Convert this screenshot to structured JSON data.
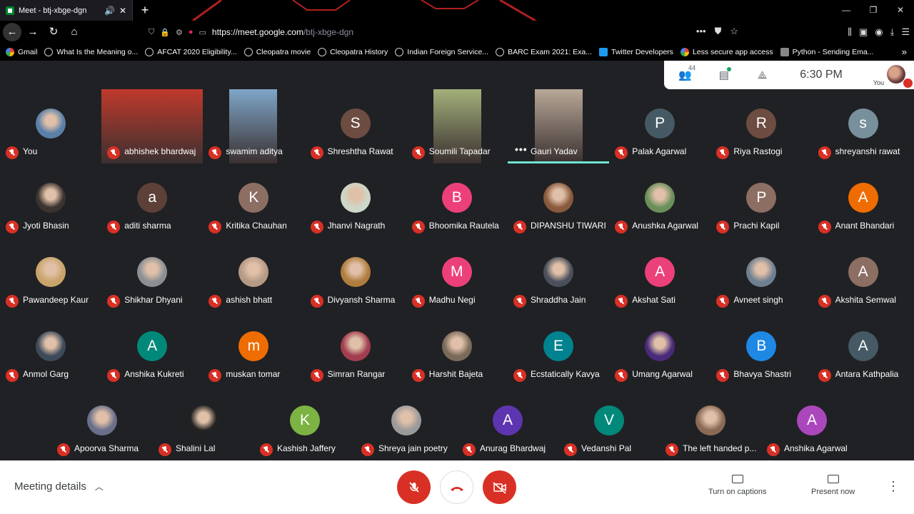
{
  "browser": {
    "tab_title": "Meet - btj-xbge-dgn",
    "url_domain": "https://meet.google.com",
    "url_path": "/btj-xbge-dgn",
    "bookmarks": [
      {
        "label": "Gmail",
        "icon": "google-icon"
      },
      {
        "label": "What Is the Meaning o...",
        "icon": "globe-icon"
      },
      {
        "label": "AFCAT 2020 Eligibility...",
        "icon": "globe-icon"
      },
      {
        "label": "Cleopatra movie",
        "icon": "globe-icon"
      },
      {
        "label": "Cleopatra History",
        "icon": "globe-icon"
      },
      {
        "label": "Indian Foreign Service...",
        "icon": "globe-icon"
      },
      {
        "label": "BARC Exam 2021: Exa...",
        "icon": "globe-icon"
      },
      {
        "label": "Twitter Developers",
        "icon": "twitter-icon"
      },
      {
        "label": "Less secure app access",
        "icon": "google-icon"
      },
      {
        "label": "Python - Sending Ema...",
        "icon": "python-icon"
      }
    ]
  },
  "meet": {
    "participant_count": "44",
    "time": "6:30 PM",
    "self_label": "You",
    "participants": [
      {
        "name": "You",
        "type": "photo",
        "color": "#5a7fa8"
      },
      {
        "name": "abhishek bhardwaj",
        "type": "video",
        "color": "#c0392b"
      },
      {
        "name": "swamim aditya",
        "type": "video",
        "color": "#7fa6c9"
      },
      {
        "name": "Shreshtha Rawat",
        "type": "letter",
        "letter": "S",
        "color": "#6d4c41"
      },
      {
        "name": "Soumili Tapadar",
        "type": "video",
        "color": "#a3b07a"
      },
      {
        "name": "Gauri Yadav",
        "type": "video",
        "color": "#b8a898",
        "speaking": true
      },
      {
        "name": "Palak Agarwal",
        "type": "letter",
        "letter": "P",
        "color": "#455a64"
      },
      {
        "name": "Riya Rastogi",
        "type": "letter",
        "letter": "R",
        "color": "#6d4c41"
      },
      {
        "name": "shreyanshi rawat",
        "type": "letter",
        "letter": "s",
        "color": "#78909c"
      },
      {
        "name": "Jyoti Bhasin",
        "type": "photo",
        "color": "#3a3330"
      },
      {
        "name": "aditi sharma",
        "type": "letter",
        "letter": "a",
        "color": "#5d4037"
      },
      {
        "name": "Kritika Chauhan",
        "type": "letter",
        "letter": "K",
        "color": "#8d6e63"
      },
      {
        "name": "Jhanvi Nagrath",
        "type": "photo",
        "color": "#cdd8c8"
      },
      {
        "name": "Bhoomika Rautela",
        "type": "letter",
        "letter": "B",
        "color": "#ec407a"
      },
      {
        "name": "DIPANSHU TIWARI",
        "type": "photo",
        "color": "#8a5a3c"
      },
      {
        "name": "Anushka Agarwal",
        "type": "photo",
        "color": "#6b8f5a"
      },
      {
        "name": "Prachi Kapil",
        "type": "letter",
        "letter": "P",
        "color": "#8d6e63"
      },
      {
        "name": "Anant Bhandari",
        "type": "letter",
        "letter": "A",
        "color": "#ef6c00"
      },
      {
        "name": "Pawandeep Kaur",
        "type": "photo",
        "color": "#c9a46a"
      },
      {
        "name": "Shikhar Dhyani",
        "type": "photo",
        "color": "#8b8f94"
      },
      {
        "name": "ashish bhatt",
        "type": "photo",
        "color": "#b59a86"
      },
      {
        "name": "Divyansh Sharma",
        "type": "photo",
        "color": "#b07d3e"
      },
      {
        "name": "Madhu Negi",
        "type": "letter",
        "letter": "M",
        "color": "#ec407a"
      },
      {
        "name": "Shraddha Jain",
        "type": "photo",
        "color": "#4a4f5c"
      },
      {
        "name": "Akshat Sati",
        "type": "letter",
        "letter": "A",
        "color": "#ec407a"
      },
      {
        "name": "Avneet singh",
        "type": "photo",
        "color": "#6e7f91"
      },
      {
        "name": "Akshita Semwal",
        "type": "letter",
        "letter": "A",
        "color": "#8d6e63"
      },
      {
        "name": "Anmol Garg",
        "type": "photo",
        "color": "#3d4a5a"
      },
      {
        "name": "Anshika Kukreti",
        "type": "letter",
        "letter": "A",
        "color": "#00897b"
      },
      {
        "name": "muskan tomar",
        "type": "letter",
        "letter": "m",
        "color": "#ef6c00"
      },
      {
        "name": "Simran Rangar",
        "type": "photo",
        "color": "#a13d4f"
      },
      {
        "name": "Harshit Bajeta",
        "type": "photo",
        "color": "#7a6a5a"
      },
      {
        "name": "Ecstatically Kavya",
        "type": "letter",
        "letter": "E",
        "color": "#00838f"
      },
      {
        "name": "Umang Agarwal",
        "type": "photo",
        "color": "#4a2a7a"
      },
      {
        "name": "Bhavya Shastri",
        "type": "letter",
        "letter": "B",
        "color": "#1e88e5"
      },
      {
        "name": "Antara Kathpalia",
        "type": "letter",
        "letter": "A",
        "color": "#455a64"
      },
      {
        "name": "Apoorva Sharma",
        "type": "photo",
        "color": "#6a6f8a"
      },
      {
        "name": "Shalini Lal",
        "type": "photo",
        "color": "#222222"
      },
      {
        "name": "Kashish Jaffery",
        "type": "letter",
        "letter": "K",
        "color": "#7cb342"
      },
      {
        "name": "Shreya jain poetry",
        "type": "photo",
        "color": "#9a9a9a"
      },
      {
        "name": "Anurag Bhardwaj",
        "type": "letter",
        "letter": "A",
        "color": "#5e35b1"
      },
      {
        "name": "Vedanshi Pal",
        "type": "letter",
        "letter": "V",
        "color": "#00897b"
      },
      {
        "name": "The left handed p...",
        "type": "photo",
        "color": "#8a6a55"
      },
      {
        "name": "Anshika Agarwal",
        "type": "letter",
        "letter": "A",
        "color": "#ab47bc"
      }
    ]
  },
  "bottom": {
    "meeting_details": "Meeting details",
    "captions": "Turn on captions",
    "present": "Present now"
  }
}
